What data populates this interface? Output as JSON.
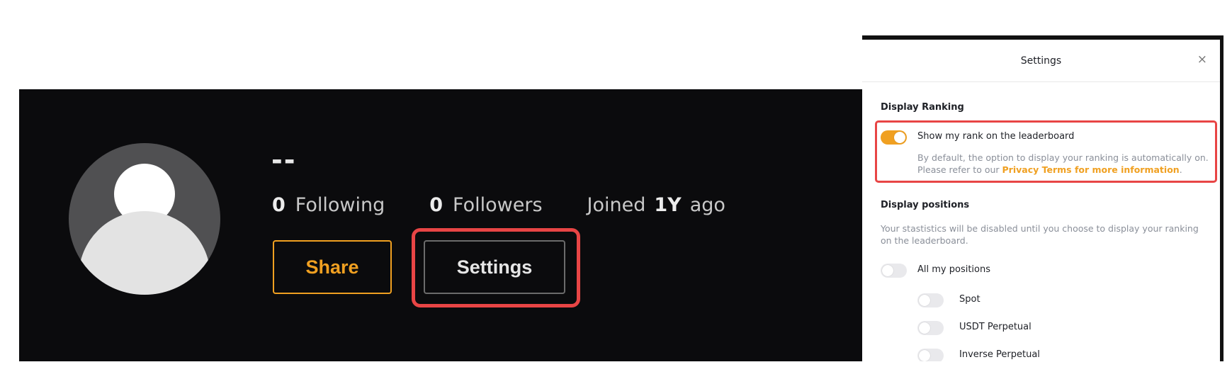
{
  "profile": {
    "username": "--",
    "stats": [
      {
        "value": "0",
        "label": "Following"
      },
      {
        "value": "0",
        "label": "Followers"
      }
    ],
    "joined": {
      "prefix": "Joined",
      "value": "1Y",
      "suffix": "ago"
    },
    "buttons": {
      "share": "Share",
      "settings": "Settings"
    }
  },
  "settings_modal": {
    "title": "Settings",
    "close_icon": "×",
    "display_ranking": {
      "title": "Display Ranking",
      "toggle_label": "Show my rank on the leaderboard",
      "toggle_on": true,
      "desc_line1": "By default, the option to display your ranking is automatically on.",
      "desc_line2_prefix": "Please refer to our ",
      "desc_link": "Privacy Terms for more information",
      "desc_line2_suffix": "."
    },
    "display_positions": {
      "title": "Display positions",
      "desc": "Your stastistics will be disabled until you choose to display your ranking on the leaderboard.",
      "all_label": "All my positions",
      "items": [
        {
          "label": "Spot",
          "on": false
        },
        {
          "label": "USDT Perpetual",
          "on": false
        },
        {
          "label": "Inverse Perpetual",
          "on": false
        }
      ]
    }
  },
  "colors": {
    "accent": "#f0a021",
    "highlight": "#e84545",
    "panel_bg": "#0b0b0d"
  }
}
